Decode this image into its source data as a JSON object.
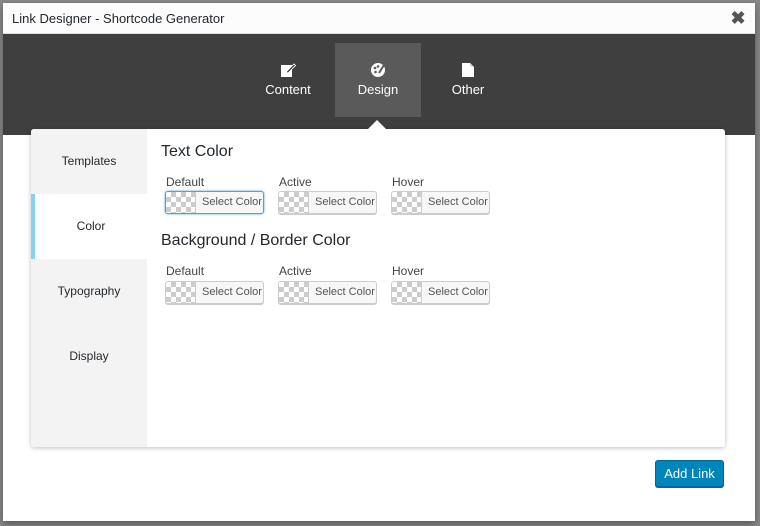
{
  "window": {
    "title": "Link Designer - Shortcode Generator",
    "close_glyph": "✖"
  },
  "topnav": {
    "tabs": [
      {
        "label": "Content",
        "icon": "edit-icon"
      },
      {
        "label": "Design",
        "icon": "palette-icon"
      },
      {
        "label": "Other",
        "icon": "page-edit-icon"
      }
    ],
    "active": "Design"
  },
  "sidebar": {
    "items": [
      {
        "label": "Templates"
      },
      {
        "label": "Color"
      },
      {
        "label": "Typography"
      },
      {
        "label": "Display"
      }
    ],
    "active": "Color"
  },
  "sections": [
    {
      "title": "Text Color",
      "fields": [
        {
          "label": "Default",
          "button": "Select Color"
        },
        {
          "label": "Active",
          "button": "Select Color"
        },
        {
          "label": "Hover",
          "button": "Select Color"
        }
      ]
    },
    {
      "title": "Background / Border Color",
      "fields": [
        {
          "label": "Default",
          "button": "Select Color"
        },
        {
          "label": "Active",
          "button": "Select Color"
        },
        {
          "label": "Hover",
          "button": "Select Color"
        }
      ]
    }
  ],
  "footer": {
    "add_label": "Add Link"
  },
  "colors": {
    "nav_bg": "#3f3f3f",
    "nav_active": "#5a5a5a",
    "accent": "#88d1ef",
    "primary": "#0085ba"
  }
}
